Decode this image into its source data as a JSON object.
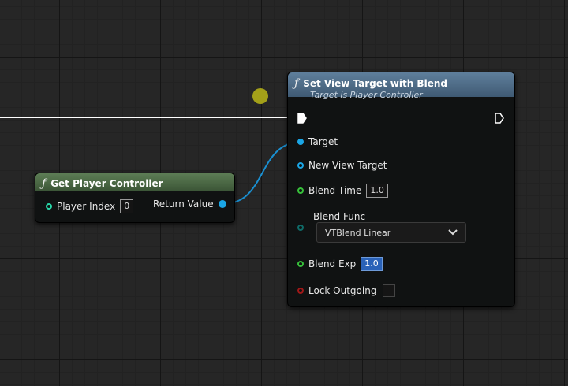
{
  "set_view_target_node": {
    "title": "Set View Target with Blend",
    "subtitle": "Target is Player Controller",
    "fn_icon": "ƒ",
    "header_color": "#4f6b85",
    "pins": {
      "target": "Target",
      "new_view_target": "New View Target",
      "blend_time": "Blend Time",
      "blend_time_value": "1.0",
      "blend_func": "Blend Func",
      "blend_func_value": "VTBlend Linear",
      "blend_exp": "Blend Exp",
      "blend_exp_value": "1.0",
      "lock_outgoing": "Lock Outgoing"
    }
  },
  "get_player_controller_node": {
    "title": "Get Player Controller",
    "fn_icon": "ƒ",
    "header_color": "#4b6a45",
    "pins": {
      "player_index": "Player Index",
      "player_index_value": "0",
      "return_value": "Return Value"
    }
  },
  "pin_colors": {
    "object": "#1aa6e6",
    "float": "#37c13b",
    "byte": "#0f6b68",
    "bool": "#8a1515",
    "int": "#27d7a8",
    "exec": "#ffffff"
  }
}
